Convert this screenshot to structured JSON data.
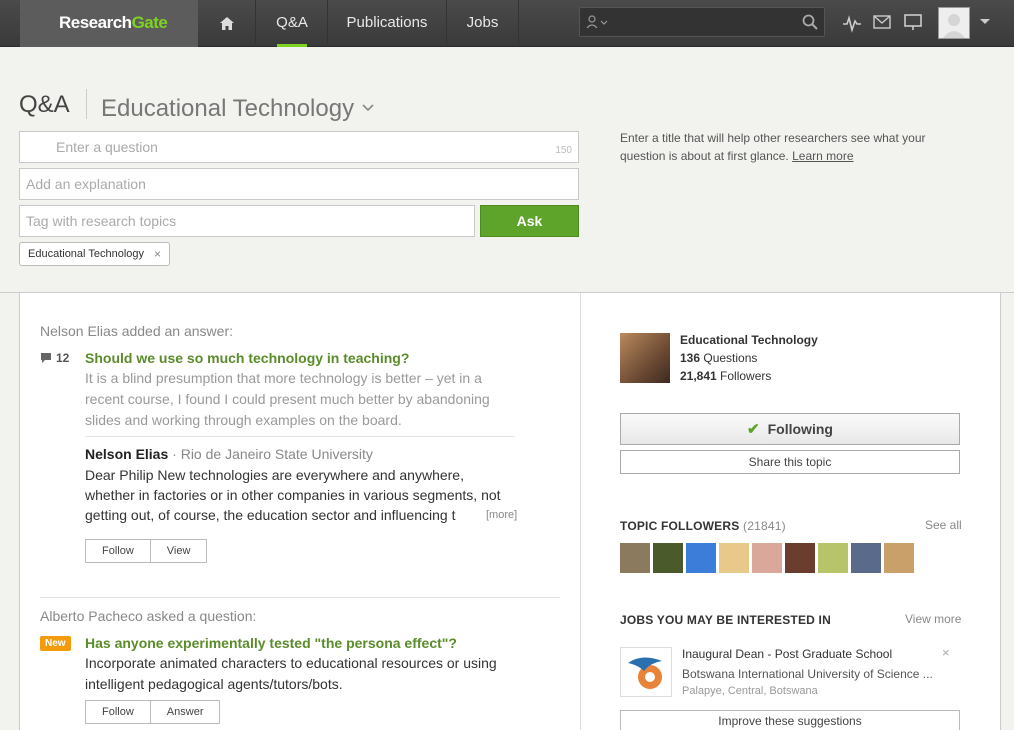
{
  "nav": {
    "logo_main": "Research",
    "logo_accent": "Gate",
    "items": [
      {
        "label": "Q&A",
        "active": true
      },
      {
        "label": "Publications",
        "active": false
      },
      {
        "label": "Jobs",
        "active": false
      }
    ],
    "search_placeholder": ""
  },
  "header": {
    "section": "Q&A",
    "topic": "Educational Technology"
  },
  "form": {
    "question_placeholder": "Enter a question",
    "char_limit": "150",
    "explanation_placeholder": "Add an explanation",
    "tags_placeholder": "Tag with research topics",
    "ask_label": "Ask",
    "tag_chip": "Educational Technology",
    "tag_remove": "×",
    "hint_text": "Enter a title that will help other researchers see what your question is about at first glance.",
    "hint_link": "Learn more"
  },
  "feed": [
    {
      "activity": "Nelson Elias added an answer:",
      "answer_count": "12",
      "question": "Should we use so much technology in teaching?",
      "snippet": "It is a blind presumption that more technology is better – yet in a recent course, I found I could present much better by abandoning slides and working through examples on the board.",
      "answer_author": "Nelson Elias",
      "answer_institution": "· Rio de Janeiro State University",
      "answer_text": "Dear Philip New technologies are everywhere and anywhere, whether in factories or in other companies in various segments, not getting out, of course, the education sector and influencing t",
      "more_label": "[more]",
      "actions": [
        "Follow",
        "View"
      ]
    },
    {
      "activity": "Alberto Pacheco asked a question:",
      "badge": "New",
      "question": "Has anyone experimentally tested \"the persona effect\"?",
      "text": "Incorporate animated characters to educational resources or using intelligent pedagogical agents/tutors/bots.",
      "actions": [
        "Follow",
        "Answer"
      ]
    }
  ],
  "sidebar": {
    "topic_name": "Educational Technology",
    "questions_count": "136",
    "questions_label": "Questions",
    "followers_count": "21,841",
    "followers_label": "Followers",
    "following_label": "Following",
    "share_label": "Share this topic",
    "followers_heading": "TOPIC FOLLOWERS",
    "followers_total": "(21841)",
    "see_all": "See all",
    "jobs_heading": "JOBS YOU MAY BE INTERESTED IN",
    "view_more": "View more",
    "job_title": "Inaugural Dean - Post Graduate School",
    "job_org": "Botswana International University of Science ...",
    "job_location": "Palapye, Central, Botswana",
    "job_dismiss": "×",
    "improve_label": "Improve these suggestions",
    "face_colors": [
      "#8b7a5e",
      "#4a5a2a",
      "#3b7dd8",
      "#e8c98a",
      "#d9a89a",
      "#6a3d2e",
      "#b8c46a",
      "#5a6a8a",
      "#caa06a"
    ]
  },
  "colors": {
    "accent": "#7ed321",
    "link_green": "#5a8c2a",
    "ask_button": "#5ea32a",
    "new_badge": "#f39b0b"
  }
}
